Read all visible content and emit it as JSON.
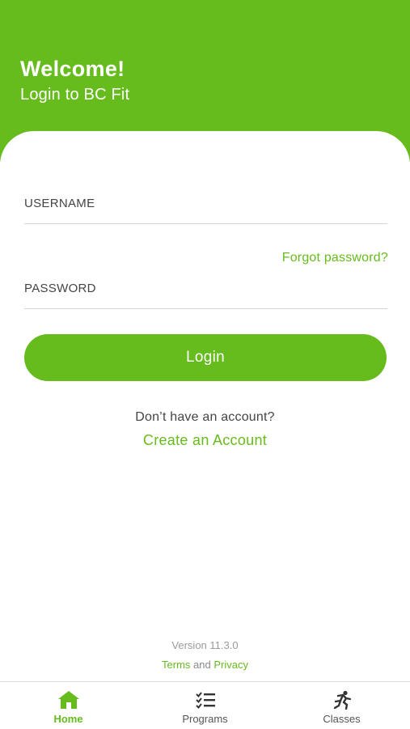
{
  "header": {
    "title": "Welcome!",
    "subtitle": "Login to BC Fit"
  },
  "form": {
    "username_label": "USERNAME",
    "username_value": "",
    "forgot_password": "Forgot password?",
    "password_label": "PASSWORD",
    "password_value": "",
    "login_button": "Login"
  },
  "signup": {
    "prompt": "Don’t have an account?",
    "create_link": "Create an Account"
  },
  "footer": {
    "version": "Version 11.3.0",
    "terms": "Terms",
    "and": "and",
    "privacy": "Privacy"
  },
  "tabbar": {
    "items": [
      {
        "label": "Home",
        "icon": "home-icon",
        "active": true
      },
      {
        "label": "Programs",
        "icon": "checklist-icon",
        "active": false
      },
      {
        "label": "Classes",
        "icon": "running-person-icon",
        "active": false
      }
    ]
  },
  "colors": {
    "brand": "#66bc1c",
    "text": "#444444",
    "muted": "#9a9a9a"
  }
}
